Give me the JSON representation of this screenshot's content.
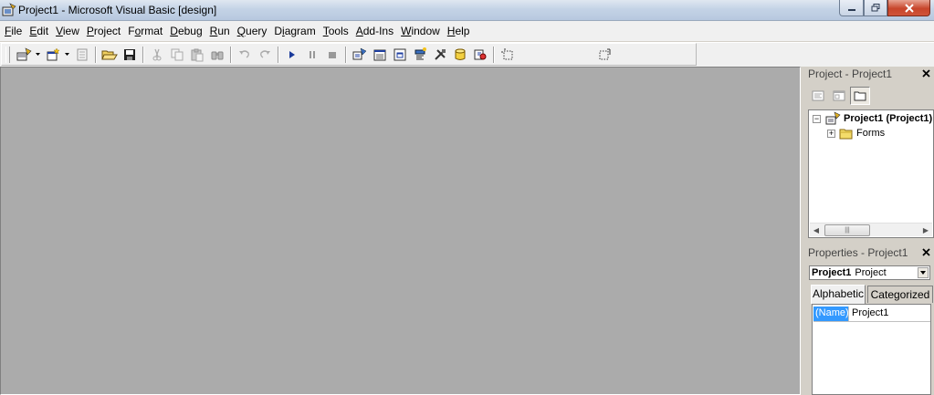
{
  "window": {
    "title": "Project1 - Microsoft Visual Basic [design]"
  },
  "menu": [
    {
      "pre": "",
      "ul": "F",
      "post": "ile"
    },
    {
      "pre": "",
      "ul": "E",
      "post": "dit"
    },
    {
      "pre": "",
      "ul": "V",
      "post": "iew"
    },
    {
      "pre": "",
      "ul": "P",
      "post": "roject"
    },
    {
      "pre": "F",
      "ul": "o",
      "post": "rmat"
    },
    {
      "pre": "",
      "ul": "D",
      "post": "ebug"
    },
    {
      "pre": "",
      "ul": "R",
      "post": "un"
    },
    {
      "pre": "",
      "ul": "Q",
      "post": "uery"
    },
    {
      "pre": "D",
      "ul": "i",
      "post": "agram"
    },
    {
      "pre": "",
      "ul": "T",
      "post": "ools"
    },
    {
      "pre": "",
      "ul": "A",
      "post": "dd-Ins"
    },
    {
      "pre": "",
      "ul": "W",
      "post": "indow"
    },
    {
      "pre": "",
      "ul": "H",
      "post": "elp"
    }
  ],
  "project_panel": {
    "title": "Project - Project1",
    "tree": {
      "root_label": "Project1 (Project1)",
      "forms_label": "Forms"
    }
  },
  "properties_panel": {
    "title": "Properties - Project1",
    "object_name": "Project1",
    "object_type": "Project",
    "tabs": [
      "Alphabetic",
      "Categorized"
    ],
    "rows": [
      {
        "name": "(Name)",
        "value": "Project1"
      }
    ]
  },
  "colors": {
    "mdi_background": "#ababab",
    "selection": "#3399ff"
  }
}
